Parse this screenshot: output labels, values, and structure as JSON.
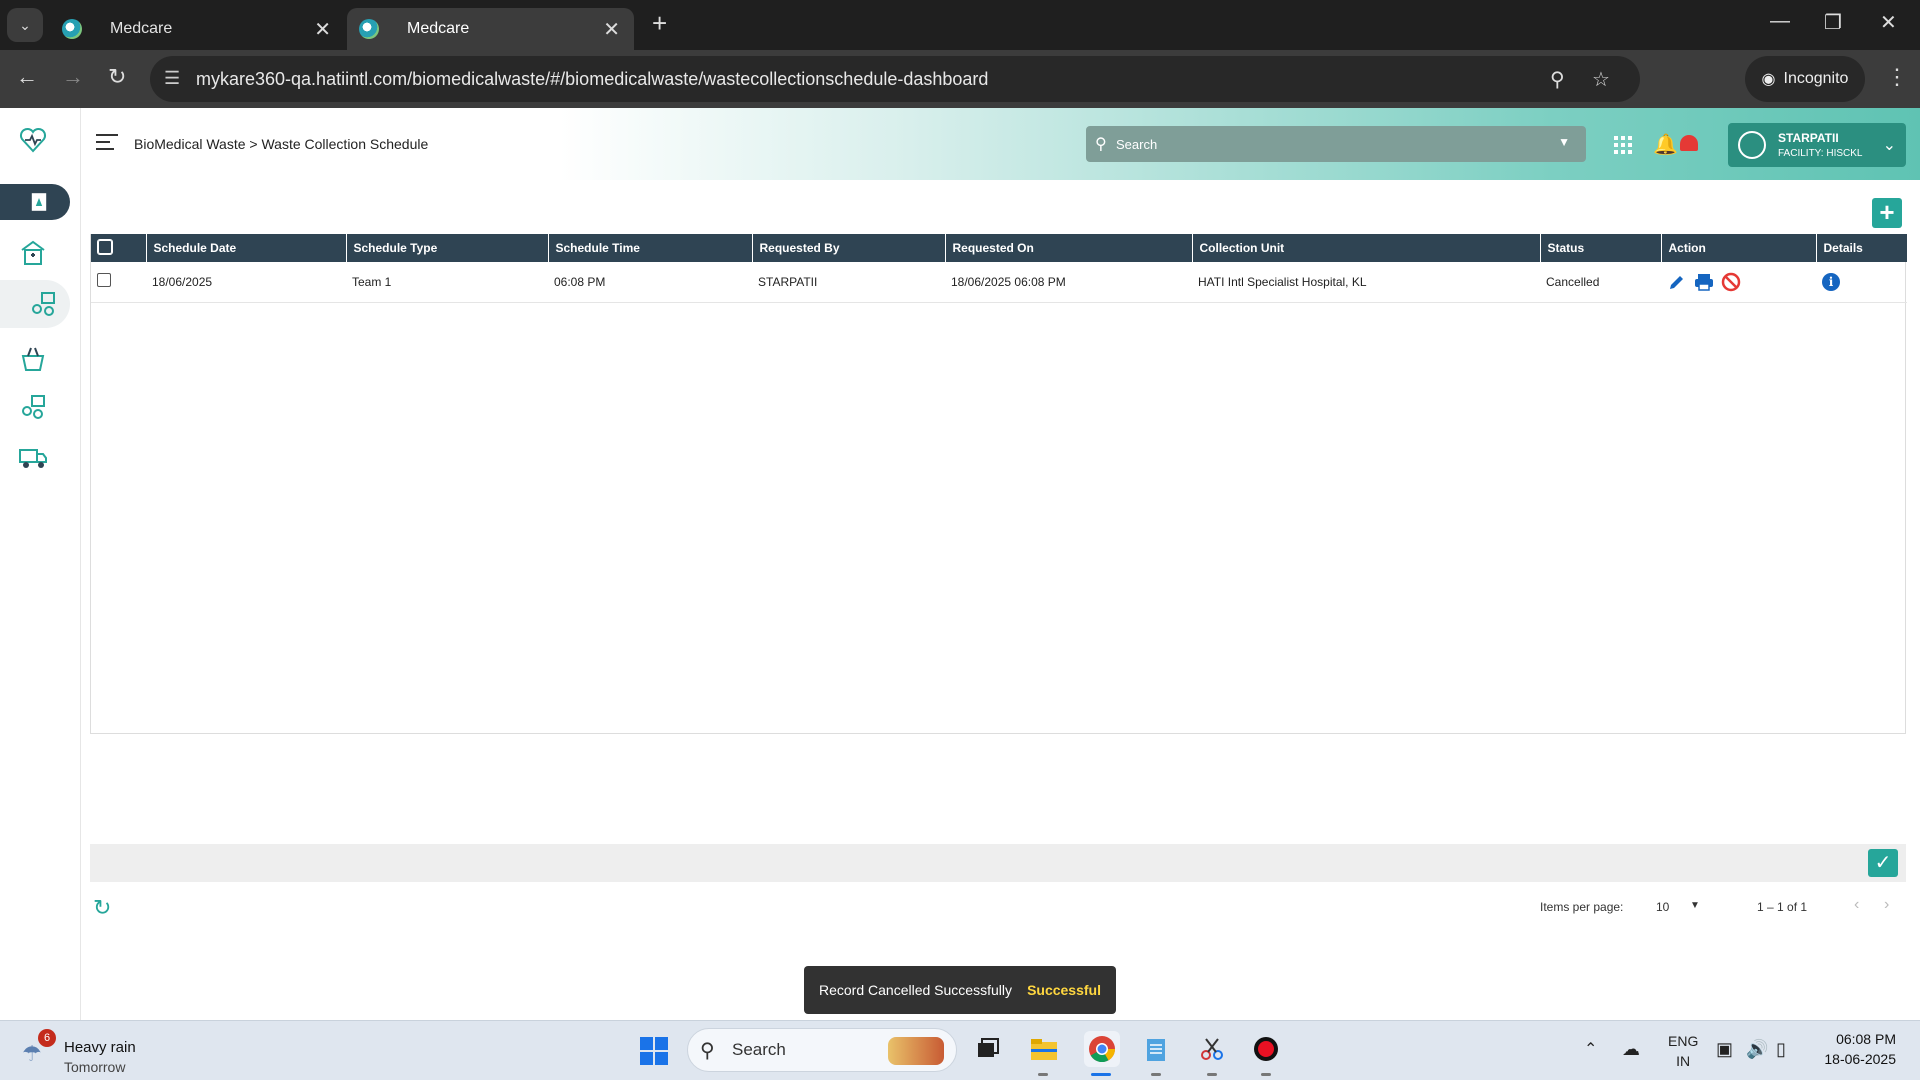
{
  "browser": {
    "tabs": [
      {
        "title": "Medcare"
      },
      {
        "title": "Medcare"
      }
    ],
    "url": "mykare360-qa.hatiintl.com/biomedicalwaste/#/biomedicalwaste/wastecollectionschedule-dashboard",
    "incognito_label": "Incognito"
  },
  "header": {
    "breadcrumb": "BioMedical Waste > Waste Collection Schedule",
    "search_placeholder": "Search",
    "user_name": "STARPATII",
    "facility": "FACILITY: HISCKL"
  },
  "table": {
    "columns": [
      "Schedule Date",
      "Schedule Type",
      "Schedule Time",
      "Requested By",
      "Requested On",
      "Collection Unit",
      "Status",
      "Action",
      "Details"
    ],
    "rows": [
      {
        "schedule_date": "18/06/2025",
        "schedule_type": "Team 1",
        "schedule_time": "06:08 PM",
        "requested_by": "STARPATII",
        "requested_on": "18/06/2025 06:08 PM",
        "collection_unit": "HATI Intl Specialist Hospital, KL",
        "status": "Cancelled"
      }
    ]
  },
  "paginator": {
    "items_per_page_label": "Items per page:",
    "items_per_page": "10",
    "range": "1 – 1 of 1"
  },
  "snackbar": {
    "message": "Record Cancelled Successfully",
    "action": "Successful"
  },
  "taskbar": {
    "weather_badge": "6",
    "weather_title": "Heavy rain",
    "weather_sub": "Tomorrow",
    "search_label": "Search",
    "lang_top": "ENG",
    "lang_bottom": "IN",
    "time": "06:08 PM",
    "date": "18-06-2025"
  },
  "colors": {
    "header_dark": "#2f4453",
    "accent_teal": "#26a69a",
    "edit_blue": "#1565c0",
    "cancel_red": "#e53935",
    "snack_action": "#ffd740"
  }
}
